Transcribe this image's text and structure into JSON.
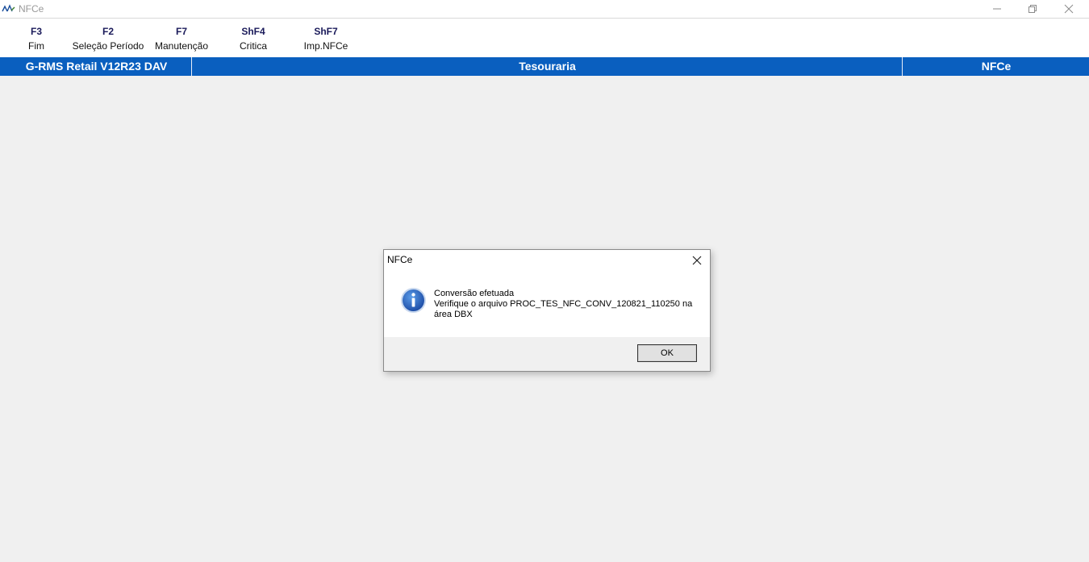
{
  "window": {
    "title": "NFCe"
  },
  "toolbar": {
    "items": [
      {
        "key": "F3",
        "label": "Fim"
      },
      {
        "key": "F2",
        "label": "Seleção Período"
      },
      {
        "key": "F7",
        "label": "Manutenção"
      },
      {
        "key": "ShF4",
        "label": "Critica"
      },
      {
        "key": "ShF7",
        "label": "Imp.NFCe"
      }
    ]
  },
  "header": {
    "system": "G-RMS Retail V12R23 DAV",
    "module": "Tesouraria",
    "program": "NFCe"
  },
  "dialog": {
    "title": "NFCe",
    "line1": "Conversão efetuada",
    "line2": "Verifique o arquivo PROC_TES_NFC_CONV_120821_110250 na",
    "line3": "área DBX",
    "ok_label": "OK",
    "icon": "info-icon"
  },
  "colors": {
    "header_bar": "#0a5fbf",
    "key_text": "#1a1a5a",
    "info_icon": "#1f63c4"
  }
}
